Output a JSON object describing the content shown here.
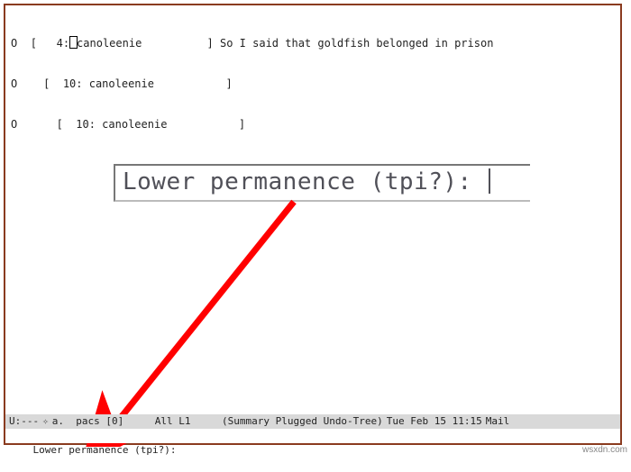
{
  "summary": {
    "rows": [
      {
        "mark": "O",
        "indent": "  ",
        "lbracket": "[",
        "count": "   4:",
        "cursor": true,
        "from": "canoleenie",
        "rbracket_col": 25,
        "subject": "So I said that goldfish belonged in prison"
      },
      {
        "mark": "O",
        "indent": "    ",
        "lbracket": "[",
        "count": "  10:",
        "cursor": false,
        "from": " canoleenie",
        "rbracket_col": 29,
        "subject": ""
      },
      {
        "mark": "O",
        "indent": "      ",
        "lbracket": "[",
        "count": "  10:",
        "cursor": false,
        "from": " canoleenie",
        "rbracket_col": 31,
        "subject": ""
      }
    ]
  },
  "callout": {
    "text": "Lower permanence (tpi?): "
  },
  "modeline": {
    "left": "U:---",
    "glyph1": "✧",
    "buffer": "a.  pacs [0]",
    "pos": "All L1",
    "modes": "(Summary Plugged Undo-Tree)",
    "time": "Tue Feb 15 11:15",
    "tail": "Mail"
  },
  "minibuffer": {
    "prompt": "Lower permanence (tpi?): "
  },
  "watermark": "wsxdn.com"
}
